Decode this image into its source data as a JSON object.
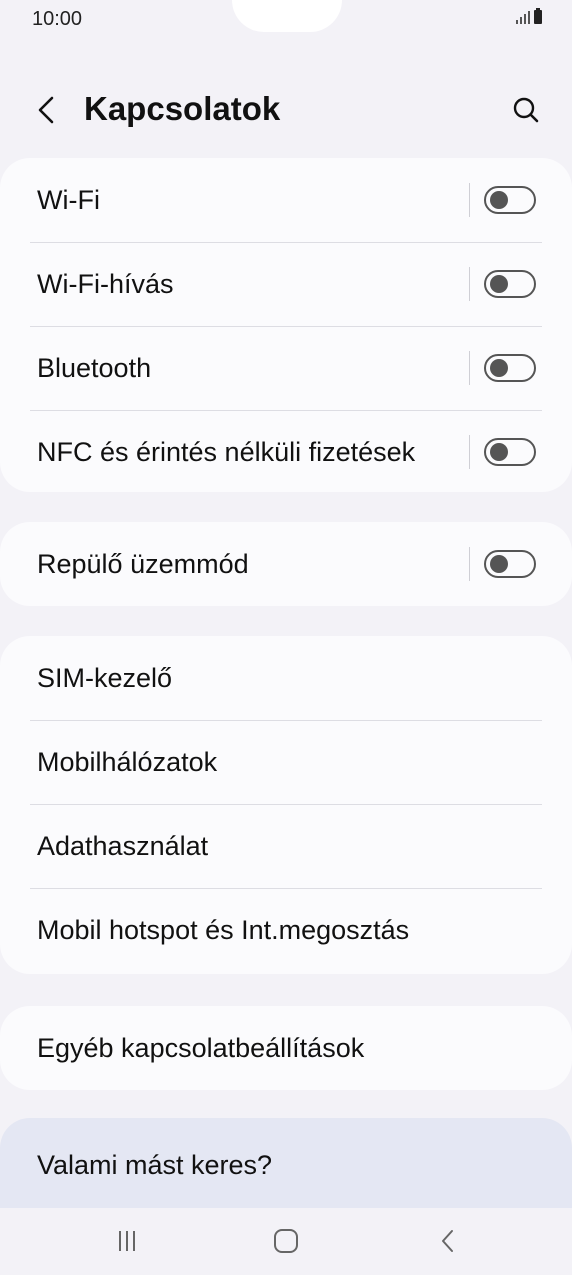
{
  "status_bar": {
    "time": "10:00"
  },
  "header": {
    "title": "Kapcsolatok"
  },
  "groups": {
    "connections": [
      {
        "label": "Wi-Fi",
        "toggle_on": false
      },
      {
        "label": "Wi-Fi-hívás",
        "toggle_on": false
      },
      {
        "label": "Bluetooth",
        "toggle_on": false
      },
      {
        "label": "NFC és érintés nélküli fizetések",
        "toggle_on": false
      }
    ],
    "airplane": [
      {
        "label": "Repülő üzemmód",
        "toggle_on": false
      }
    ],
    "mobile": [
      {
        "label": "SIM-kezelő"
      },
      {
        "label": "Mobilhálózatok"
      },
      {
        "label": "Adathasználat"
      },
      {
        "label": "Mobil hotspot és Int.megosztás"
      }
    ],
    "other": [
      {
        "label": "Egyéb kapcsolatbeállítások"
      }
    ]
  },
  "suggestion": {
    "label": "Valami mást keres?"
  },
  "icons": {
    "back": "chevron-left-icon",
    "search": "search-icon",
    "recents": "recents-icon",
    "home": "home-icon",
    "nav_back": "nav-back-icon"
  },
  "colors": {
    "background": "#f3f2f7",
    "card": "#fbfbfd",
    "suggestion": "#e4e7f3",
    "toggle_off": "#555555"
  }
}
